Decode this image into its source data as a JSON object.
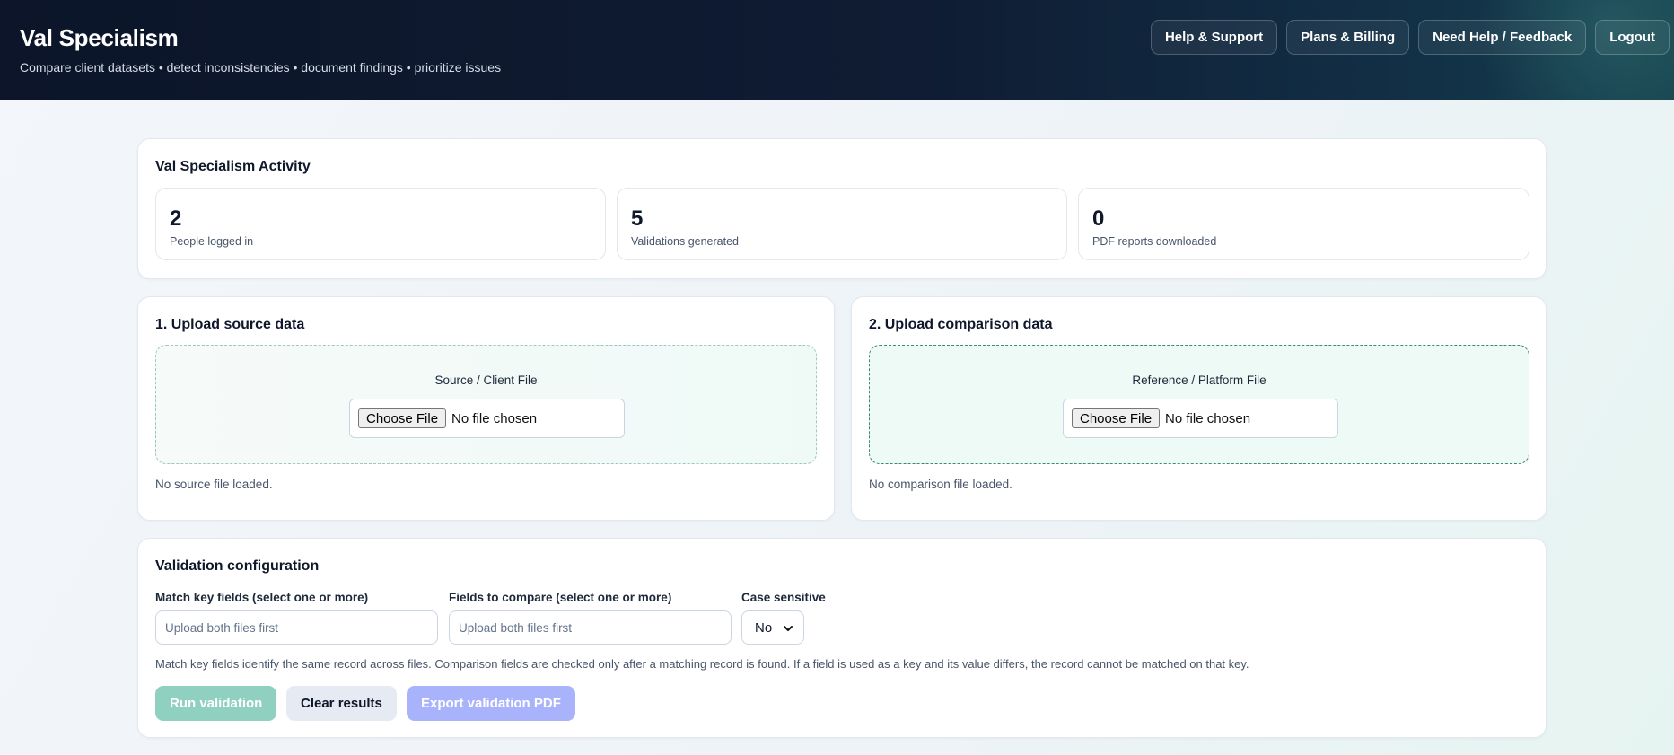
{
  "header": {
    "title": "Val Specialism",
    "subtitle": "Compare client datasets • detect inconsistencies • document findings • prioritize issues",
    "nav": [
      {
        "label": "Help & Support"
      },
      {
        "label": "Plans & Billing"
      },
      {
        "label": "Need Help / Feedback"
      },
      {
        "label": "Logout"
      }
    ]
  },
  "activity": {
    "title": "Val Specialism Activity",
    "stats": [
      {
        "value": "2",
        "label": "People logged in"
      },
      {
        "value": "5",
        "label": "Validations generated"
      },
      {
        "value": "0",
        "label": "PDF reports downloaded"
      }
    ]
  },
  "source": {
    "title": "1. Upload source data",
    "dropzone_label": "Source / Client File",
    "button": "Choose File",
    "file_text": "No file chosen",
    "status": "No source file loaded."
  },
  "comparison": {
    "title": "2. Upload comparison data",
    "dropzone_label": "Reference / Platform File",
    "button": "Choose File",
    "file_text": "No file chosen",
    "status": "No comparison file loaded."
  },
  "config": {
    "title": "Validation configuration",
    "match_key_label": "Match key fields (select one or more)",
    "match_key_placeholder": "Upload both files first",
    "compare_label": "Fields to compare (select one or more)",
    "compare_placeholder": "Upload both files first",
    "case_label": "Case sensitive",
    "case_value": "No",
    "help": "Match key fields identify the same record across files. Comparison fields are checked only after a matching record is found. If a field is used as a key and its value differs, the record cannot be matched on that key.",
    "run_label": "Run validation",
    "clear_label": "Clear results",
    "export_label": "Export validation PDF"
  },
  "colors": {
    "header_bg": "#0f1c33",
    "accent_teal": "#8fd0c1",
    "accent_indigo": "#a9b3fb"
  }
}
